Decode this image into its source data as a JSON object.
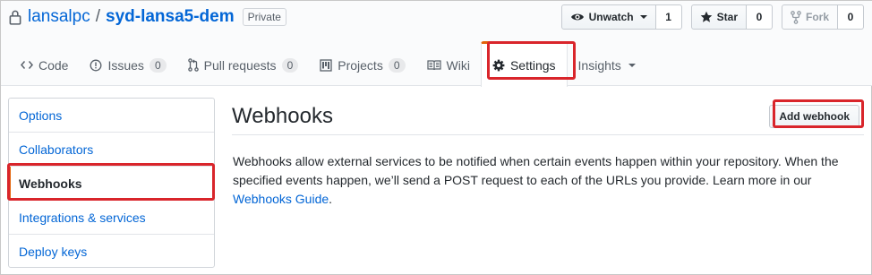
{
  "repo": {
    "owner": "lansalpc",
    "separator": "/",
    "name": "syd-lansa5-dem",
    "visibility": "Private"
  },
  "actions": {
    "watch": {
      "label": "Unwatch",
      "count": "1"
    },
    "star": {
      "label": "Star",
      "count": "0"
    },
    "fork": {
      "label": "Fork",
      "count": "0"
    }
  },
  "tabs": [
    {
      "label": "Code",
      "icon": "code-icon"
    },
    {
      "label": "Issues",
      "icon": "issue-icon",
      "count": "0"
    },
    {
      "label": "Pull requests",
      "icon": "pull-request-icon",
      "count": "0"
    },
    {
      "label": "Projects",
      "icon": "project-icon",
      "count": "0"
    },
    {
      "label": "Wiki",
      "icon": "book-icon"
    },
    {
      "label": "Settings",
      "icon": "gear-icon",
      "selected": true
    },
    {
      "label": "Insights",
      "icon": "chevron-down-icon"
    }
  ],
  "sidebar": {
    "items": [
      {
        "label": "Options"
      },
      {
        "label": "Collaborators"
      },
      {
        "label": "Webhooks",
        "selected": true
      },
      {
        "label": "Integrations & services"
      },
      {
        "label": "Deploy keys"
      }
    ]
  },
  "main": {
    "title": "Webhooks",
    "add_button": "Add webhook",
    "description": "Webhooks allow external services to be notified when certain events happen within your repository. When the specified events happen, we’ll send a POST request to each of the URLs you provide. Learn more in our",
    "link_text": "Webhooks Guide",
    "period": "."
  },
  "colors": {
    "link": "#0366d6",
    "selected_accent": "#e36209",
    "annotation": "#d9252b"
  }
}
